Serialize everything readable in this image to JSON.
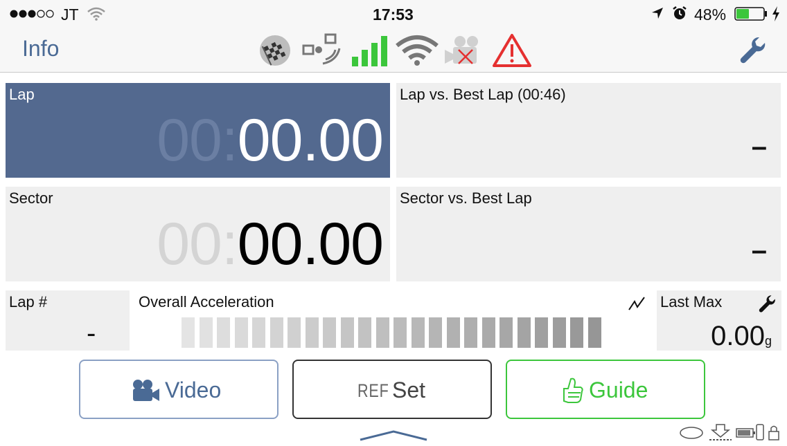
{
  "status_bar": {
    "carrier": "JT",
    "time": "17:53",
    "battery_percent": "48%",
    "battery_level": 0.48,
    "signal_dots_filled": 3,
    "signal_dots_total": 5
  },
  "toolbar": {
    "info_label": "Info",
    "icons": [
      "checkered-flag-icon",
      "satellite-icon",
      "cell-signal-icon",
      "wifi-icon",
      "camera-disconnected-icon",
      "warning-icon",
      "wrench-icon"
    ],
    "signal_color": "#3cc63c",
    "warning_color": "#e53030"
  },
  "lap": {
    "label": "Lap",
    "time_prefix": "00:",
    "time_value": "00.00",
    "bg_color": "#53698f"
  },
  "lap_vs_best": {
    "label": "Lap vs. Best Lap (00:46)",
    "value": "–"
  },
  "sector": {
    "label": "Sector",
    "time_prefix": "00:",
    "time_value": "00.00"
  },
  "sector_vs_best": {
    "label": "Sector vs. Best Lap",
    "value": "–"
  },
  "lap_number": {
    "label": "Lap #",
    "value": "-"
  },
  "acceleration": {
    "label": "Overall Acceleration",
    "segments": 24
  },
  "last_max": {
    "label": "Last Max",
    "value": "0.00",
    "unit": "g"
  },
  "buttons": {
    "video_label": "Video",
    "ref_prefix": "REF",
    "ref_label": "Set",
    "guide_label": "Guide",
    "guide_color": "#3cc63c",
    "video_color": "#4a6a95"
  }
}
